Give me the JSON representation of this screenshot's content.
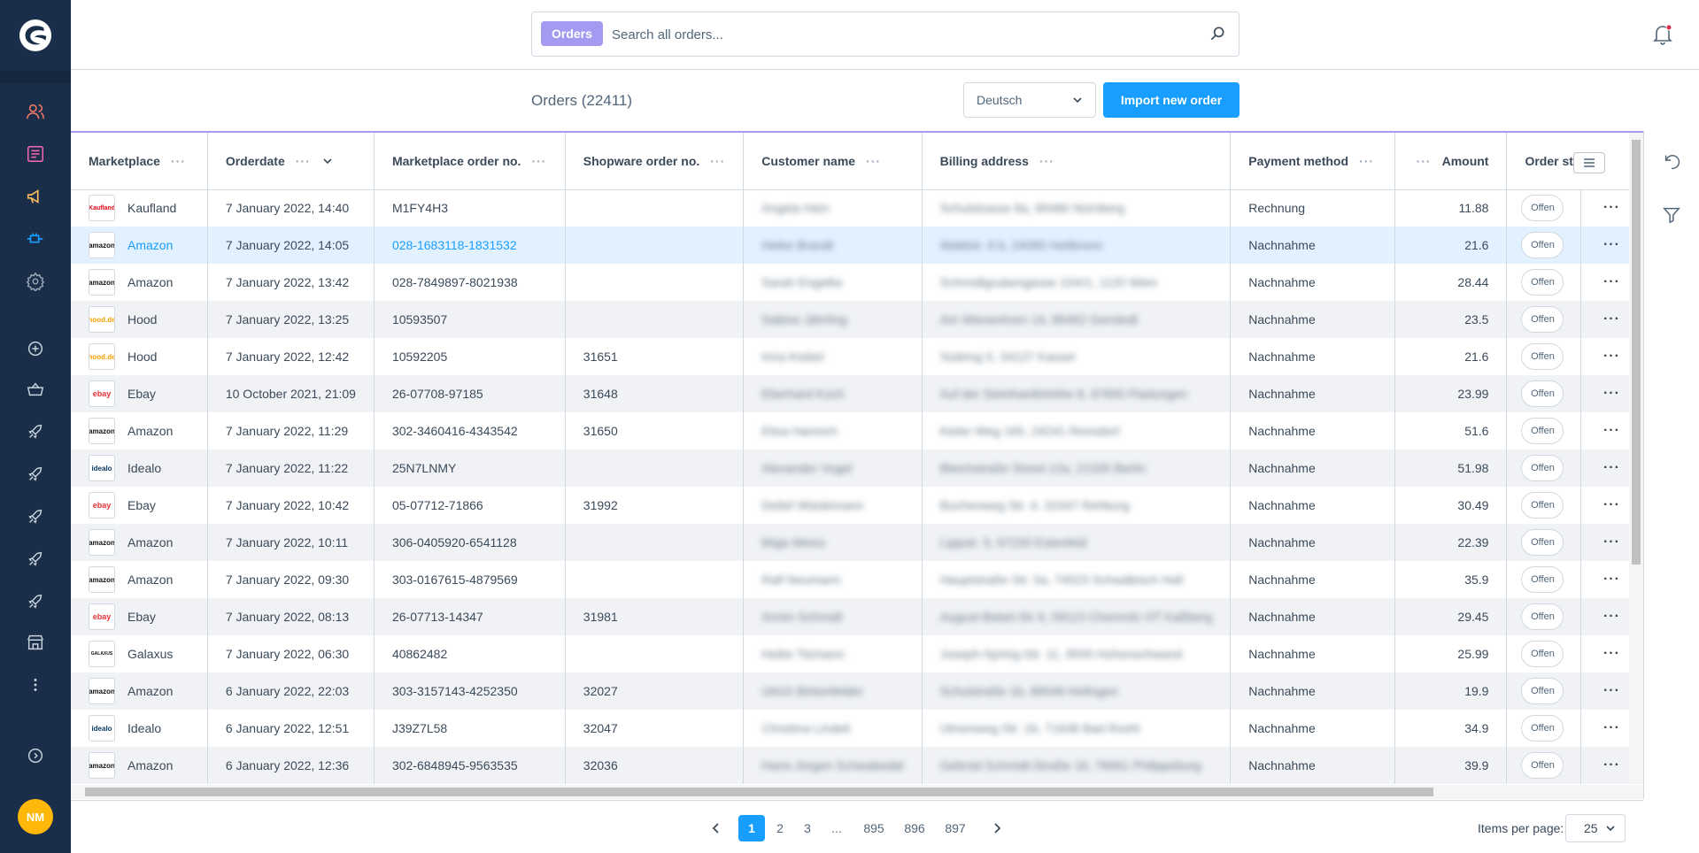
{
  "search": {
    "tag": "Orders",
    "placeholder": "Search all orders..."
  },
  "header": {
    "title": "Orders",
    "count": "(22411)",
    "language": "Deutsch",
    "import_button": "Import new order"
  },
  "columns": [
    "Marketplace",
    "Orderdate",
    "Marketplace order no.",
    "Shopware order no.",
    "Customer name",
    "Billing address",
    "Payment method",
    "Amount",
    "Order state"
  ],
  "rows": [
    {
      "marketplace": "Kaufland",
      "logo": "Kaufland",
      "date": "7 January 2022, 14:40",
      "mp_no": "M1FY4H3",
      "sw_no": "",
      "customer": "Angela Hein",
      "address": "Schulstrasse 8a, 90480 Nürnberg",
      "payment": "Rechnung",
      "amount": "11.88",
      "state": "Offen"
    },
    {
      "marketplace": "Amazon",
      "logo": "amazon",
      "date": "7 January 2022, 14:05",
      "mp_no": "028-1683118-1831532",
      "sw_no": "",
      "customer": "Heike Brandt",
      "address": "Waldstr. 8 b, 24085 Heilbronn",
      "payment": "Nachnahme",
      "amount": "21.6",
      "state": "Offen"
    },
    {
      "marketplace": "Amazon",
      "logo": "amazon",
      "date": "7 January 2022, 13:42",
      "mp_no": "028-7849897-8021938",
      "sw_no": "",
      "customer": "Sarah Engelke",
      "address": "Schmidtgrubengasse 10A/1, 1120 Wien",
      "payment": "Nachnahme",
      "amount": "28.44",
      "state": "Offen"
    },
    {
      "marketplace": "Hood",
      "logo": "hood.de",
      "date": "7 January 2022, 13:25",
      "mp_no": "10593507",
      "sw_no": "",
      "customer": "Sabine Jährling",
      "address": "Am Wiesenhorn 14, 86462 Gerstedt",
      "payment": "Nachnahme",
      "amount": "23.5",
      "state": "Offen"
    },
    {
      "marketplace": "Hood",
      "logo": "hood.de",
      "date": "7 January 2022, 12:42",
      "mp_no": "10592205",
      "sw_no": "31651",
      "customer": "Irina Kiebel",
      "address": "Südring 5, 34127 Kassel",
      "payment": "Nachnahme",
      "amount": "21.6",
      "state": "Offen"
    },
    {
      "marketplace": "Ebay",
      "logo": "ebay",
      "date": "10 October 2021, 21:09",
      "mp_no": "26-07708-97185",
      "sw_no": "31648",
      "customer": "Eberhard Koch",
      "address": "Auf der Steinhardtshöhe 8, 97650 Fladungen",
      "payment": "Nachnahme",
      "amount": "23.99",
      "state": "Offen"
    },
    {
      "marketplace": "Amazon",
      "logo": "amazon",
      "date": "7 January 2022, 11:29",
      "mp_no": "302-3460416-4343542",
      "sw_no": "31650",
      "customer": "Elisa Hannich",
      "address": "Kieler Weg 165, 24241 Reesdorf",
      "payment": "Nachnahme",
      "amount": "51.6",
      "state": "Offen"
    },
    {
      "marketplace": "Idealo",
      "logo": "idealo",
      "date": "7 January 2022, 11:22",
      "mp_no": "25N7LNMY",
      "sw_no": "",
      "customer": "Alexander Vogel",
      "address": "Bleichstraße Street 12a, 21335 Berlin",
      "payment": "Nachnahme",
      "amount": "51.98",
      "state": "Offen"
    },
    {
      "marketplace": "Ebay",
      "logo": "ebay",
      "date": "7 January 2022, 10:42",
      "mp_no": "05-07712-71866",
      "sw_no": "31992",
      "customer": "Detlef Wiedemann",
      "address": "Buchenweg Str. 4, 31547 Rehburg",
      "payment": "Nachnahme",
      "amount": "30.49",
      "state": "Offen"
    },
    {
      "marketplace": "Amazon",
      "logo": "amazon",
      "date": "7 January 2022, 10:11",
      "mp_no": "306-0405920-6541128",
      "sw_no": "",
      "customer": "Maja Weiss",
      "address": "Lippstr. 5, 97230 Estenfeld",
      "payment": "Nachnahme",
      "amount": "22.39",
      "state": "Offen"
    },
    {
      "marketplace": "Amazon",
      "logo": "amazon",
      "date": "7 January 2022, 09:30",
      "mp_no": "303-0167615-4879569",
      "sw_no": "",
      "customer": "Ralf Neumann",
      "address": "Hauptstraße Str. 5a, 74523 Schwäbisch Hall",
      "payment": "Nachnahme",
      "amount": "35.9",
      "state": "Offen"
    },
    {
      "marketplace": "Ebay",
      "logo": "ebay",
      "date": "7 January 2022, 08:13",
      "mp_no": "26-07713-14347",
      "sw_no": "31981",
      "customer": "Armin Schmidt",
      "address": "August-Bebel-Str 6, 09113 Chemnitz OT Kaßberg",
      "payment": "Nachnahme",
      "amount": "29.45",
      "state": "Offen"
    },
    {
      "marketplace": "Galaxus",
      "logo": "GALAXUS",
      "date": "7 January 2022, 06:30",
      "mp_no": "40862482",
      "sw_no": "",
      "customer": "Heike Tiemann",
      "address": "Joseph-Spring-Str. 11, 9555 Hohenschwand",
      "payment": "Nachnahme",
      "amount": "25.99",
      "state": "Offen"
    },
    {
      "marketplace": "Amazon",
      "logo": "amazon",
      "date": "6 January 2022, 22:03",
      "mp_no": "303-3157143-4252350",
      "sw_no": "32027",
      "customer": "Ulrich Birkenfelder",
      "address": "Schulstraße 1b, 88048 Hofingen",
      "payment": "Nachnahme",
      "amount": "19.9",
      "state": "Offen"
    },
    {
      "marketplace": "Idealo",
      "logo": "idealo",
      "date": "6 January 2022, 12:51",
      "mp_no": "J39Z7L58",
      "sw_no": "32047",
      "customer": "Christina Lindell",
      "address": "Ulmenweg Str. 16, 71638 Bad Roshl",
      "payment": "Nachnahme",
      "amount": "34.9",
      "state": "Offen"
    },
    {
      "marketplace": "Amazon",
      "logo": "amazon",
      "date": "6 January 2022, 12:36",
      "mp_no": "302-6848945-9563535",
      "sw_no": "32036",
      "customer": "Hans-Jürgen Schwabedal",
      "address": "Gebrüd Schmidt-Straße 16, 76661 Philippsburg",
      "payment": "Nachnahme",
      "amount": "39.9",
      "state": "Offen"
    }
  ],
  "pagination": {
    "pages": [
      "1",
      "2",
      "3",
      "...",
      "895",
      "896",
      "897"
    ],
    "items_label": "Items per page:",
    "items_value": "25"
  },
  "avatar": "NM",
  "colors": {
    "sidebar": "#1b2e49",
    "accent": "#189eff",
    "tag": "#a59af2",
    "avatar": "#ffb80a"
  }
}
